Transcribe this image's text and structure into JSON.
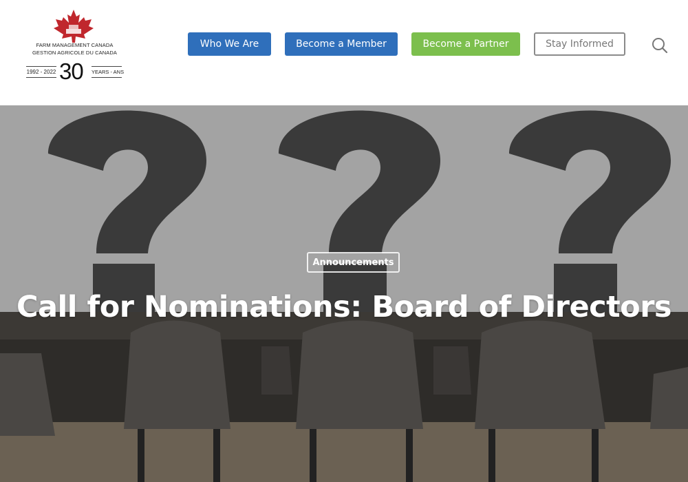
{
  "logo": {
    "org_en": "FARM MANAGEMENT CANADA",
    "org_fr": "GESTION AGRICOLE DU CANADA",
    "years_range": "1992 - 2022",
    "years_number": "30",
    "years_label": "YEARS - ANS",
    "leaf_color": "#c0272d"
  },
  "nav": {
    "who_we_are": "Who We Are",
    "become_member": "Become a Member",
    "become_partner": "Become a Partner",
    "stay_informed": "Stay Informed",
    "search_icon": "search-icon"
  },
  "colors": {
    "primary_blue": "#2f6fbb",
    "partner_green": "#7cbf4d",
    "outline_gray": "#8a8a8a"
  },
  "hero": {
    "category": "Announcements",
    "title": "Call for Nominations: Board of Directors"
  }
}
